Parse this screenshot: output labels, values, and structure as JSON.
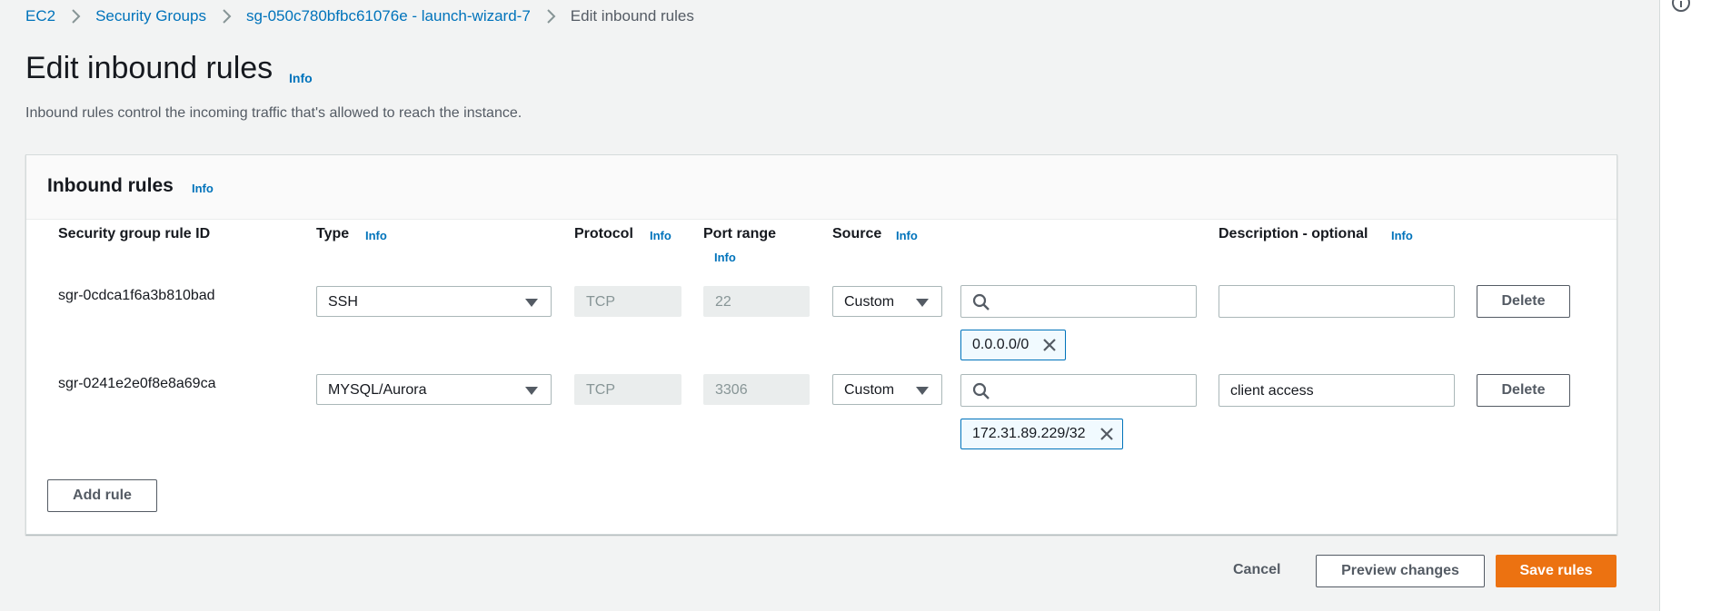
{
  "breadcrumb": {
    "items": [
      "EC2",
      "Security Groups",
      "sg-050c780bfbc61076e - launch-wizard-7"
    ],
    "current": "Edit inbound rules"
  },
  "page": {
    "title": "Edit inbound rules",
    "info": "Info",
    "description": "Inbound rules control the incoming traffic that's allowed to reach the instance."
  },
  "panel": {
    "title": "Inbound rules",
    "info": "Info",
    "columns": {
      "rule_id": "Security group rule ID",
      "type": "Type",
      "protocol": "Protocol",
      "port_range": "Port range",
      "source": "Source",
      "description": "Description - optional",
      "info": "Info"
    },
    "rows": [
      {
        "rule_id": "sgr-0cdca1f6a3b810bad",
        "type": "SSH",
        "protocol": "TCP",
        "port_range": "22",
        "source_type": "Custom",
        "source_value": "0.0.0.0/0",
        "description": "",
        "delete_label": "Delete"
      },
      {
        "rule_id": "sgr-0241e2e0f8e8a69ca",
        "type": "MYSQL/Aurora",
        "protocol": "TCP",
        "port_range": "3306",
        "source_type": "Custom",
        "source_value": "172.31.89.229/32",
        "description": "client access",
        "delete_label": "Delete"
      }
    ],
    "add_rule_label": "Add rule"
  },
  "footer": {
    "cancel_label": "Cancel",
    "preview_label": "Preview changes",
    "save_label": "Save rules"
  },
  "colors": {
    "link": "#0073bb",
    "primary": "#ec7211",
    "background": "#f2f3f3"
  }
}
